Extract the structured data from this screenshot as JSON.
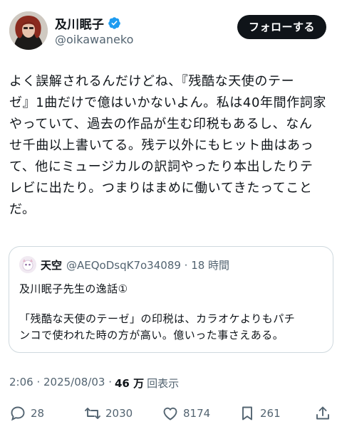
{
  "author": {
    "display_name": "及川眠子",
    "handle": "@oikawaneko",
    "verified_icon": "verified-badge-icon",
    "avatar_icon": "profile-photo"
  },
  "follow_label": "フォローする",
  "tweet": {
    "text": "よく誤解されるんだけどね、『残酷な天使のテー\nゼ』1曲だけで億はいかないよん。私は40年間作詞家\nやっていて、過去の作品が生む印税もあるし、なん\nせ千曲以上書いてる。残テ以外にもヒット曲はあっ\nて、他にミュージカルの訳詞やったり本出したりテ\nレビに出たり。つまりはまめに働いてきたってこと\nだ。"
  },
  "quote": {
    "name": "天空",
    "handle_time": "@AEQoDsqK7o34089 · 18 時間",
    "line1": "及川眠子先生の逸話①",
    "body": "「残酷な天使のテーゼ」の印税は、カラオケよりもパチ\nンコで使われた時の方が高い。億いった事さえある。"
  },
  "meta": {
    "time_date": "2:06 · 2025/08/03 ·",
    "views_count": "46 万",
    "views_label": "回表示"
  },
  "actions": {
    "replies": "28",
    "reposts": "2030",
    "likes": "8174",
    "bookmarks": "261"
  },
  "colors": {
    "text": "#0f1419",
    "secondary": "#536471",
    "border": "#cfd9de",
    "verified": "#1d9bf0"
  }
}
